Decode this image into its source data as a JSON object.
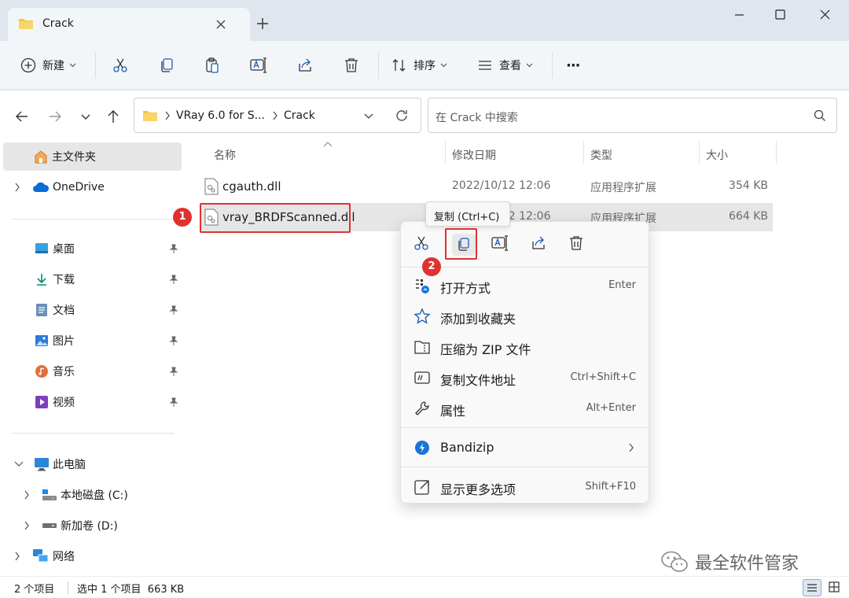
{
  "window": {
    "tab_title": "Crack",
    "new_tab": "+"
  },
  "toolbar": {
    "new_label": "新建",
    "sort_label": "排序",
    "view_label": "查看",
    "more_label": "···"
  },
  "address": {
    "path_parent": "VRay 6.0 for S...",
    "path_current": "Crack",
    "search_placeholder": "在 Crack 中搜索"
  },
  "sidebar": {
    "home": "主文件夹",
    "onedrive": "OneDrive",
    "quick": [
      "桌面",
      "下载",
      "文档",
      "图片",
      "音乐",
      "视频"
    ],
    "thispc": "此电脑",
    "drive_c": "本地磁盘 (C:)",
    "drive_d": "新加卷 (D:)",
    "network": "网络"
  },
  "columns": {
    "name": "名称",
    "date": "修改日期",
    "type": "类型",
    "size": "大小"
  },
  "files": [
    {
      "name": "cgauth.dll",
      "date": "2022/10/12 12:06",
      "type": "应用程序扩展",
      "size": "354 KB"
    },
    {
      "name": "vray_BRDFScanned.dll",
      "date": "2022/10/12 12:06",
      "type": "应用程序扩展",
      "size": "664 KB"
    }
  ],
  "tooltip": "复制 (Ctrl+C)",
  "context_menu": {
    "items": [
      {
        "label": "打开方式",
        "key": "Enter"
      },
      {
        "label": "添加到收藏夹",
        "key": ""
      },
      {
        "label": "压缩为 ZIP 文件",
        "key": ""
      },
      {
        "label": "复制文件地址",
        "key": "Ctrl+Shift+C"
      },
      {
        "label": "属性",
        "key": "Alt+Enter"
      }
    ],
    "bandizip": "Bandizip",
    "more": {
      "label": "显示更多选项",
      "key": "Shift+F10"
    }
  },
  "badges": [
    "1",
    "2"
  ],
  "status": {
    "count": "2 个项目",
    "selected": "选中 1 个项目  663 KB"
  },
  "watermark": "最全软件管家",
  "colors": {
    "accent": "#0067c0",
    "folder": "#f4c542",
    "badge": "#e03131",
    "selection": "#e6e6e6"
  }
}
